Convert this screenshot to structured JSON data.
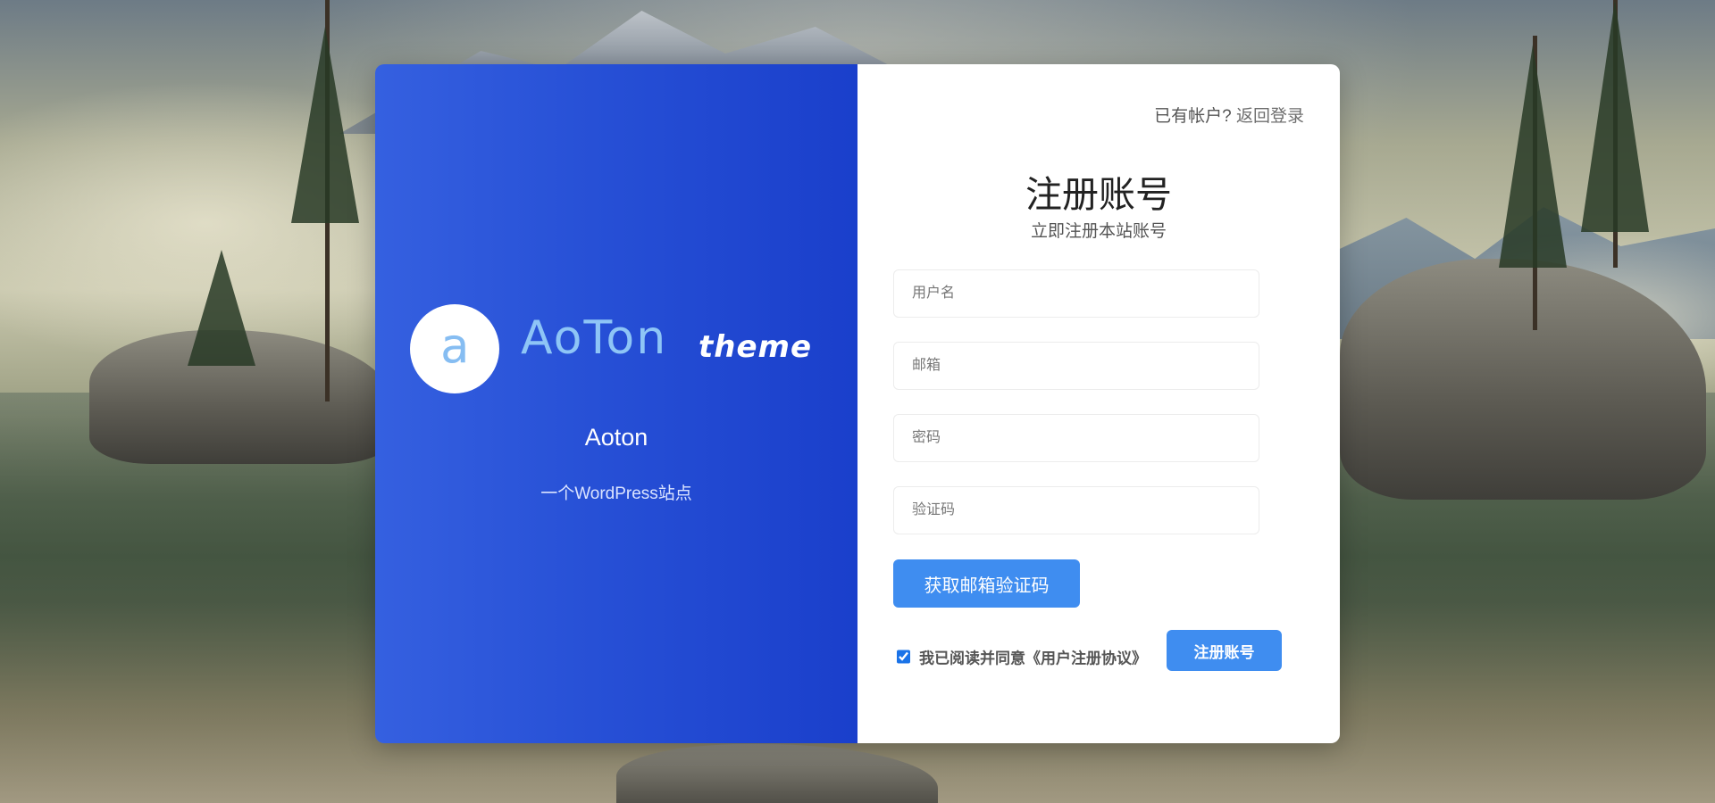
{
  "branding": {
    "logo_letter": "a",
    "logo_name": "AoTon",
    "logo_suffix": "theme",
    "site_name": "Aoton",
    "site_description": "一个WordPress站点"
  },
  "header": {
    "login_prompt": "已有帐户?",
    "login_link": "返回登录"
  },
  "form": {
    "title": "注册账号",
    "subtitle": "立即注册本站账号",
    "username_placeholder": "用户名",
    "email_placeholder": "邮箱",
    "password_placeholder": "密码",
    "captcha_placeholder": "验证码",
    "get_code_label": "获取邮箱验证码",
    "agree_text": "我已阅读并同意《用户注册协议》",
    "agree_checked": true,
    "submit_label": "注册账号"
  },
  "colors": {
    "panel_blue": "#2750d6",
    "button_blue": "#3f8df0",
    "logo_light_blue": "#8ec5f6"
  }
}
